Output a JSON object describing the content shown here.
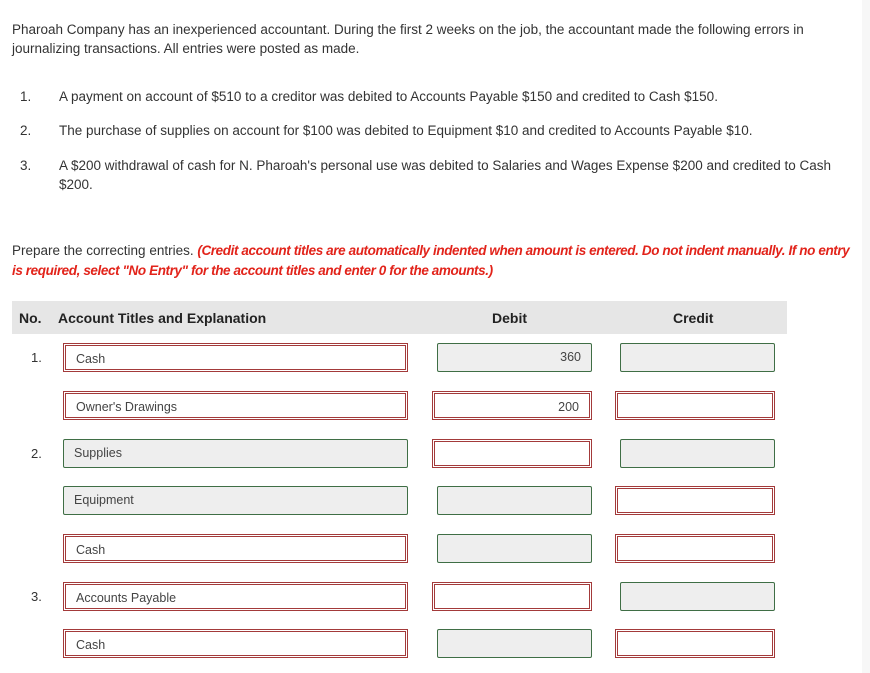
{
  "intro": "Pharoah Company has an inexperienced accountant. During the first 2 weeks on the job, the accountant made the following errors in journalizing transactions. All entries were posted as made.",
  "errors": [
    {
      "num": "1.",
      "text": "A payment on account of $510 to a creditor was debited to Accounts Payable $150 and credited to Cash $150."
    },
    {
      "num": "2.",
      "text": "The purchase of supplies on account for $100 was debited to Equipment $10 and credited to Accounts Payable $10."
    },
    {
      "num": "3.",
      "text": "A $200 withdrawal of cash for N. Pharoah's personal use was debited to Salaries and Wages Expense $200 and credited to Cash $200."
    }
  ],
  "instructions": {
    "lead": "Prepare the correcting entries. ",
    "note": "(Credit account titles are automatically indented when amount is entered. Do not indent manually. If no entry is required, select \"No Entry\" for the account titles and enter 0 for the amounts.)"
  },
  "table": {
    "headers": {
      "no": "No.",
      "account": "Account Titles and Explanation",
      "debit": "Debit",
      "credit": "Credit"
    },
    "rows": [
      {
        "no": "1.",
        "account": "Cash",
        "account_state": "incorrect",
        "debit": "360",
        "debit_state": "correct",
        "credit": "",
        "credit_state": "correct"
      },
      {
        "no": "",
        "account": "Owner's Drawings",
        "account_state": "incorrect",
        "debit": "200",
        "debit_state": "incorrect",
        "credit": "",
        "credit_state": "incorrect"
      },
      {
        "no": "2.",
        "account": "Supplies",
        "account_state": "correct",
        "debit": "",
        "debit_state": "incorrect",
        "credit": "",
        "credit_state": "correct"
      },
      {
        "no": "",
        "account": "Equipment",
        "account_state": "correct",
        "debit": "",
        "debit_state": "correct",
        "credit": "",
        "credit_state": "incorrect"
      },
      {
        "no": "",
        "account": "Cash",
        "account_state": "incorrect",
        "debit": "",
        "debit_state": "correct",
        "credit": "",
        "credit_state": "incorrect"
      },
      {
        "no": "3.",
        "account": "Accounts Payable",
        "account_state": "incorrect",
        "debit": "",
        "debit_state": "incorrect",
        "credit": "",
        "credit_state": "correct"
      },
      {
        "no": "",
        "account": "Cash",
        "account_state": "incorrect",
        "debit": "",
        "debit_state": "correct",
        "credit": "",
        "credit_state": "incorrect"
      }
    ]
  },
  "colors": {
    "incorrect_border": "#a33a3a",
    "correct_border": "#3f6e45",
    "correct_fill": "#eeeeee",
    "instruction_red": "#e2231a",
    "header_bg": "#e6e6e6"
  }
}
